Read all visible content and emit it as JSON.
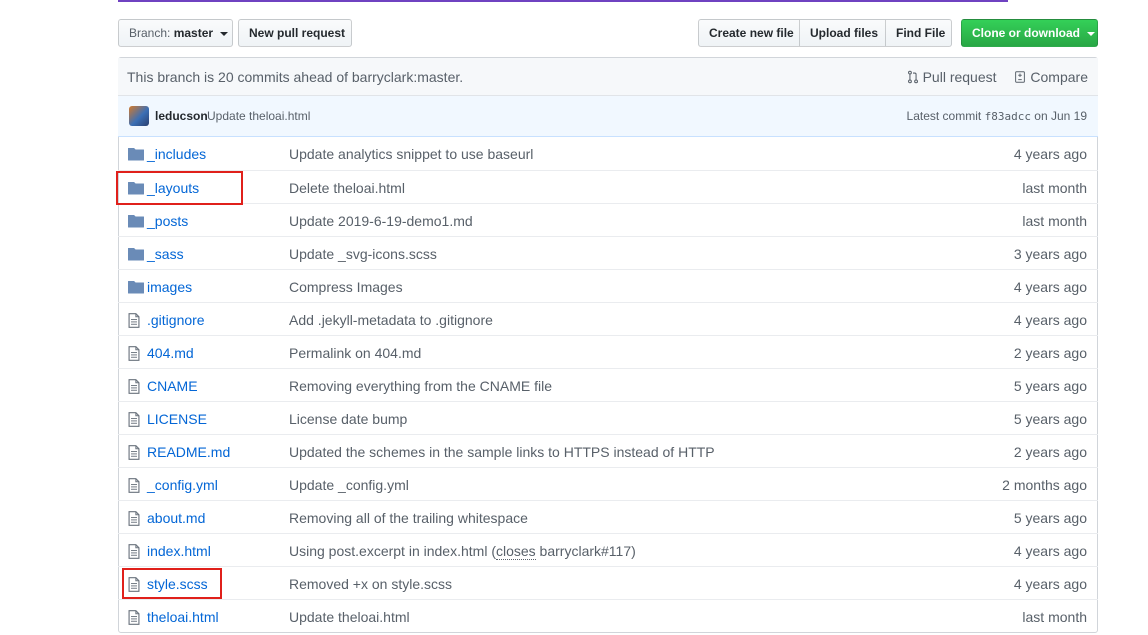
{
  "toolbar": {
    "branch_prefix": "Branch:",
    "branch_name": "master",
    "new_pull_request": "New pull request",
    "create_new_file": "Create new file",
    "upload_files": "Upload files",
    "find_file": "Find File",
    "clone_or_download": "Clone or download"
  },
  "branch_info": {
    "text": "This branch is 20 commits ahead of barryclark:master.",
    "pull_request": "Pull request",
    "compare": "Compare"
  },
  "latest_commit": {
    "author": "leducson",
    "message": "Update theloai.html",
    "label": "Latest commit",
    "sha": "f83adcc",
    "date": "on Jun 19"
  },
  "files": [
    {
      "name": "_includes",
      "type": "folder-icon",
      "message": "Update analytics snippet to use baseurl",
      "age": "4 years ago"
    },
    {
      "name": "_layouts",
      "type": "folder-icon",
      "message": "Delete theloai.html",
      "age": "last month"
    },
    {
      "name": "_posts",
      "type": "folder-icon",
      "message": "Update 2019-6-19-demo1.md",
      "age": "last month"
    },
    {
      "name": "_sass",
      "type": "folder-icon",
      "message": "Update _svg-icons.scss",
      "age": "3 years ago"
    },
    {
      "name": "images",
      "type": "folder-icon",
      "message": "Compress Images",
      "age": "4 years ago"
    },
    {
      "name": ".gitignore",
      "type": "file-icon",
      "message": "Add .jekyll-metadata to .gitignore",
      "age": "4 years ago"
    },
    {
      "name": "404.md",
      "type": "file-icon",
      "message": "Permalink on 404.md",
      "age": "2 years ago"
    },
    {
      "name": "CNAME",
      "type": "file-icon",
      "message": "Removing everything from the CNAME file",
      "age": "5 years ago"
    },
    {
      "name": "LICENSE",
      "type": "file-icon",
      "message": "License date bump",
      "age": "5 years ago"
    },
    {
      "name": "README.md",
      "type": "file-icon",
      "message": "Updated the schemes in the sample links to HTTPS instead of HTTP",
      "age": "2 years ago"
    },
    {
      "name": "_config.yml",
      "type": "file-icon",
      "message": "Update _config.yml",
      "age": "2 months ago"
    },
    {
      "name": "about.md",
      "type": "file-icon",
      "message": "Removing all of the trailing whitespace",
      "age": "5 years ago"
    },
    {
      "name": "index.html",
      "type": "file-icon",
      "message_pre": "Using post.excerpt in index.html (",
      "message_link": "closes",
      "message_post": " barryclark#117)",
      "age": "4 years ago"
    },
    {
      "name": "style.scss",
      "type": "file-icon",
      "message": "Removed +x on style.scss",
      "age": "4 years ago"
    },
    {
      "name": "theloai.html",
      "type": "file-icon",
      "message": "Update theloai.html",
      "age": "last month"
    }
  ],
  "colors": {
    "link": "#0366d6",
    "muted": "#586069",
    "clone_button": "#28a745",
    "highlight_box": "#e0201b",
    "top_strip": "#6f42c1"
  }
}
